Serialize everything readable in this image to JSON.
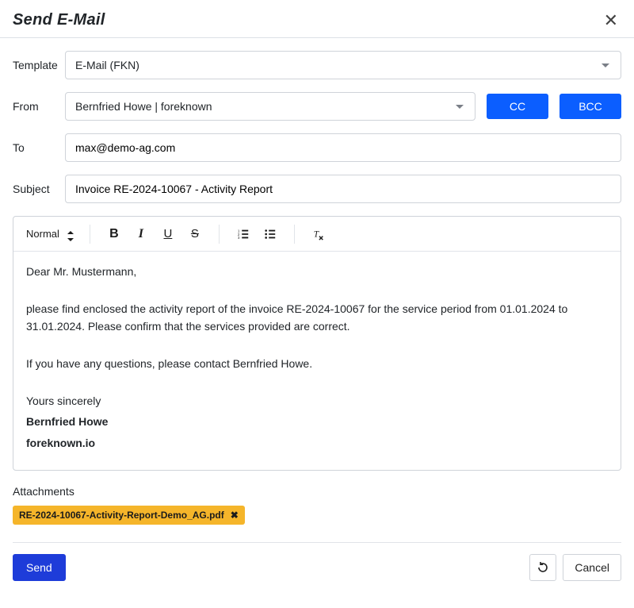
{
  "dialog": {
    "title": "Send E-Mail"
  },
  "labels": {
    "template": "Template",
    "from": "From",
    "to": "To",
    "subject": "Subject",
    "attachments": "Attachments"
  },
  "fields": {
    "template": "E-Mail (FKN)",
    "from": "Bernfried Howe | foreknown",
    "to": "max@demo-ag.com",
    "subject": "Invoice RE-2024-10067 - Activity Report"
  },
  "buttons": {
    "cc": "CC",
    "bcc": "BCC",
    "send": "Send",
    "cancel": "Cancel"
  },
  "toolbar": {
    "heading": "Normal"
  },
  "body": {
    "p1": "Dear Mr. Mustermann,",
    "p2": "please find enclosed the activity report of the invoice RE-2024-10067 for the service period from 01.01.2024 to 31.01.2024. Please confirm that the services provided are correct.",
    "p3": "If you have any questions, please contact Bernfried Howe.",
    "p4": "Yours sincerely",
    "p5": "Bernfried Howe",
    "p6": "foreknown.io"
  },
  "attachments": [
    {
      "filename": "RE-2024-10067-Activity-Report-Demo_AG.pdf"
    }
  ]
}
